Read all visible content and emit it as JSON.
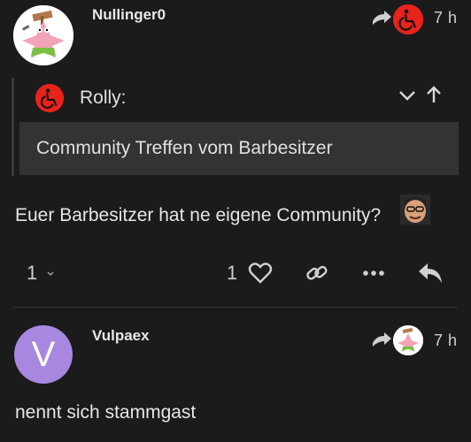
{
  "post1": {
    "username": "Nullinger0",
    "avatar_icon": "patrick-star-avatar",
    "reply_to_icon": "wheelchair-avatar",
    "time": "7 h",
    "quote": {
      "user": "Rolly:",
      "topic": "Community Treffen vom Barbesitzer"
    },
    "text": "Euer Barbesitzer hat ne eigene Community?",
    "actions": {
      "replies_count": "1",
      "likes_count": "1"
    }
  },
  "post2": {
    "username": "Vulpaex",
    "avatar_letter": "V",
    "avatar_color": "#a887e0",
    "time": "7 h",
    "text": "nennt sich stammgast"
  },
  "colors": {
    "background": "#1b1b1b",
    "quote_background": "#333333",
    "wheelchair_red": "#e8231c"
  }
}
